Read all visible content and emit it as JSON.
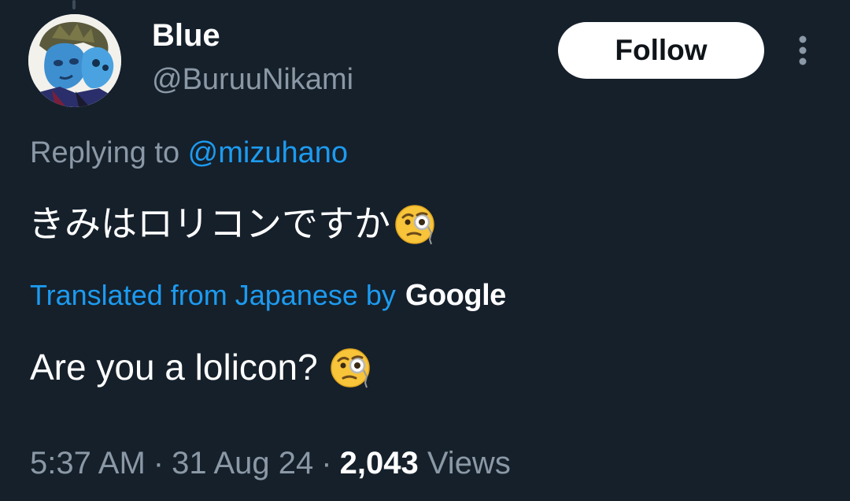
{
  "author": {
    "display_name": "Blue",
    "handle": "@BuruuNikami"
  },
  "actions": {
    "follow_label": "Follow"
  },
  "reply": {
    "prefix": "Replying to ",
    "mention": "@mizuhano"
  },
  "tweet": {
    "original_text": "きみはロリコンですか",
    "translation_label": "Translated from Japanese by",
    "translation_provider": "Google",
    "translated_text": "Are you a lolicon?",
    "emoji": "face-with-monocle"
  },
  "meta": {
    "time": "5:37 AM",
    "separator": "·",
    "date": "31 Aug 24",
    "views_count": "2,043",
    "views_label": "Views"
  },
  "colors": {
    "background": "#15202b",
    "accent": "#1d9bf0",
    "secondary_text": "#8b98a5"
  }
}
